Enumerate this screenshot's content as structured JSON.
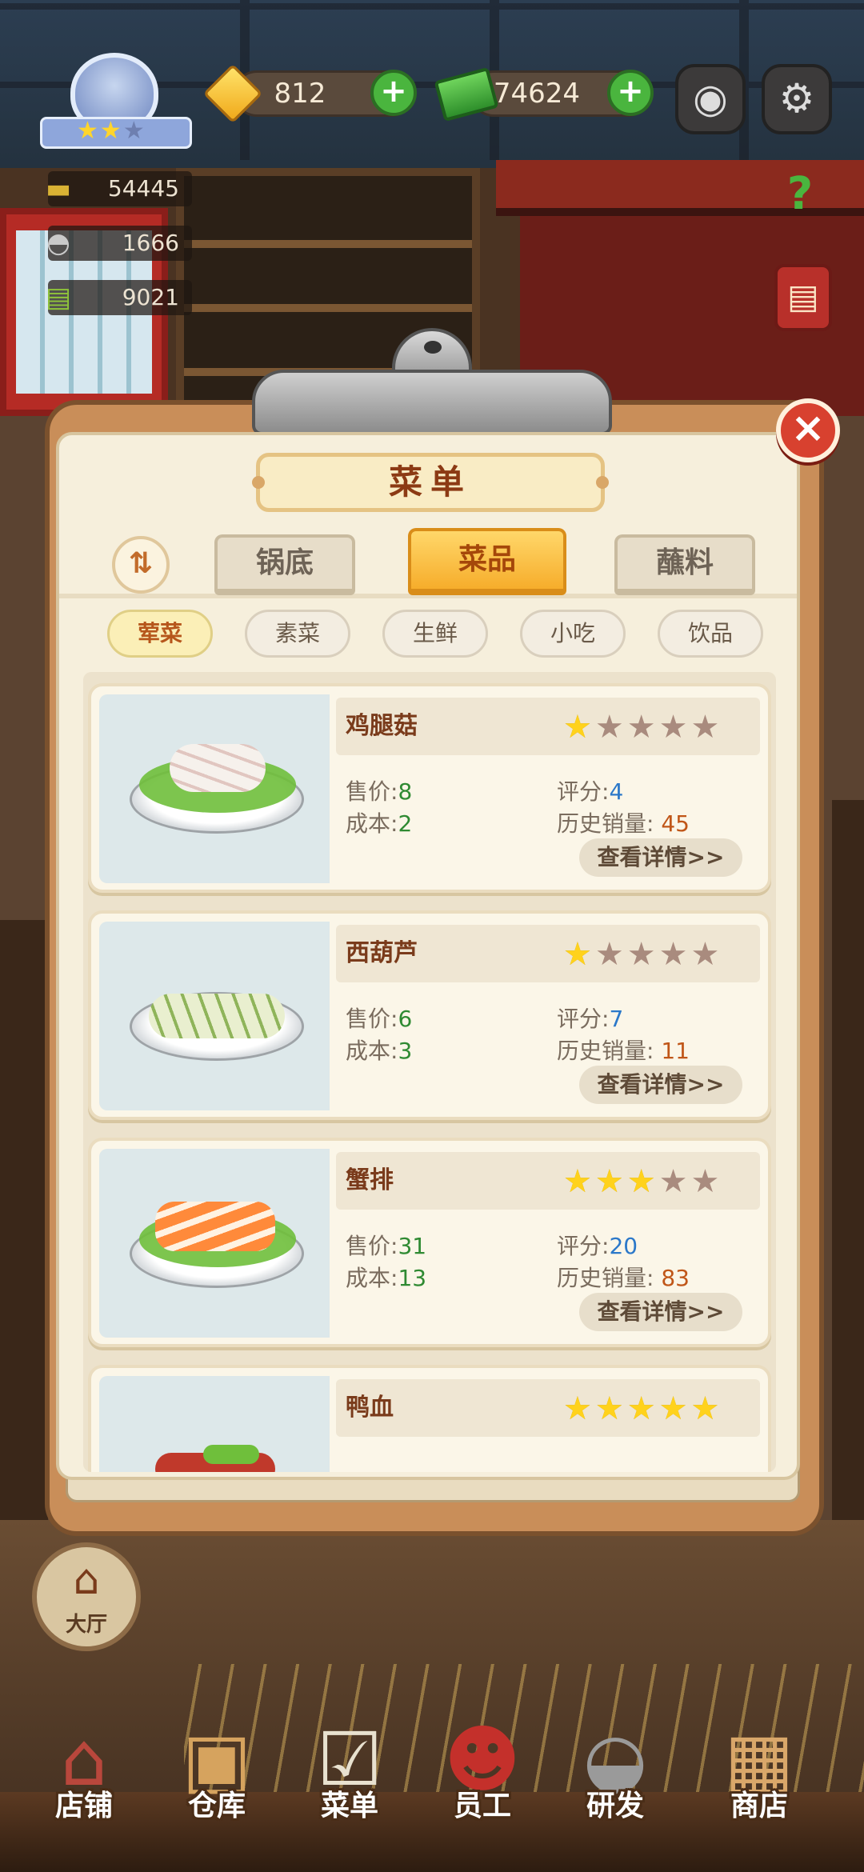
{
  "hud": {
    "gems": "812",
    "cash": "74624",
    "stats": [
      "54445",
      "1666",
      "9021"
    ],
    "badge_stars_filled": 2,
    "badge_stars_total": 3
  },
  "menu": {
    "title": "菜单",
    "tabs": [
      {
        "label": "锅底",
        "active": false
      },
      {
        "label": "菜品",
        "active": true
      },
      {
        "label": "蘸料",
        "active": false
      }
    ],
    "categories": [
      {
        "label": "荤菜",
        "active": true
      },
      {
        "label": "素菜",
        "active": false
      },
      {
        "label": "生鲜",
        "active": false
      },
      {
        "label": "小吃",
        "active": false
      },
      {
        "label": "饮品",
        "active": false
      }
    ],
    "labels": {
      "price": "售价:",
      "cost": "成本:",
      "score": "评分:",
      "sales": "历史销量:",
      "detail": "查看详情>>"
    },
    "dishes": [
      {
        "name": "鸡腿菇",
        "stars": 1,
        "price": "8",
        "cost": "2",
        "score": "4",
        "sales": "45"
      },
      {
        "name": "西葫芦",
        "stars": 1,
        "price": "6",
        "cost": "3",
        "score": "7",
        "sales": "11"
      },
      {
        "name": "蟹排",
        "stars": 3,
        "price": "31",
        "cost": "13",
        "score": "20",
        "sales": "83"
      },
      {
        "name": "鸭血",
        "stars": 5,
        "price": "",
        "cost": "",
        "score": "",
        "sales": ""
      }
    ]
  },
  "nav": {
    "hall": "大厅",
    "items": [
      "店铺",
      "仓库",
      "菜单",
      "员工",
      "研发",
      "商店"
    ]
  },
  "colors": {
    "accent_orange": "#f6ad2b",
    "title_brown": "#8c3a14",
    "value_green": "#2f8a32",
    "value_blue": "#2b78c9",
    "value_orange": "#c05618",
    "close_red": "#d8412f"
  },
  "icons": {
    "gem": "gem-icon",
    "cash": "cash-icon",
    "camera": "camera-icon",
    "settings": "gear-icon",
    "help_book": "help-book-icon",
    "close": "close-icon",
    "sort": "sort-icon"
  }
}
